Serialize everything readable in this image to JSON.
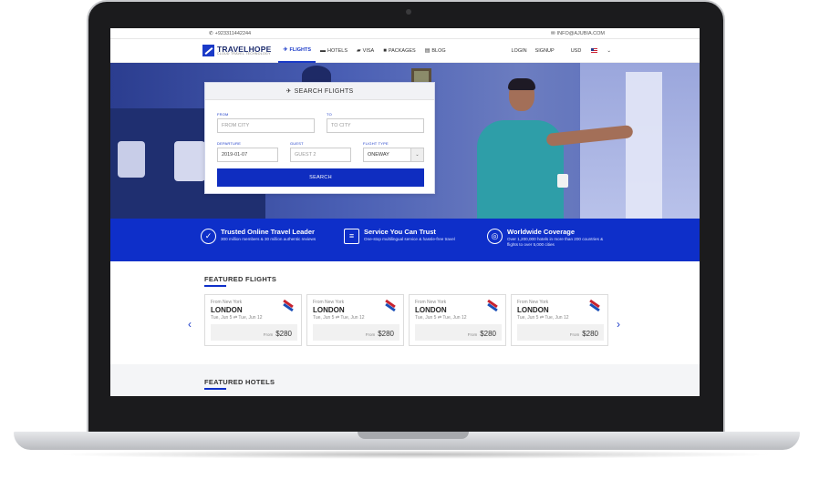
{
  "topbar": {
    "phone": "+923311442244",
    "email": "INFO@AJUBIA.COM"
  },
  "brand": {
    "name": "TRAVELHOPE",
    "tagline": "CLOUD TRAVEL TECHNOLOGY"
  },
  "nav": {
    "items": [
      {
        "label": "FLIGHTS",
        "icon": "plane-icon",
        "active": true
      },
      {
        "label": "HOTELS",
        "icon": "bed-icon"
      },
      {
        "label": "VISA",
        "icon": "passport-icon"
      },
      {
        "label": "PACKAGES",
        "icon": "suitcase-icon"
      },
      {
        "label": "BLOG",
        "icon": "document-icon"
      }
    ],
    "login": "LOGIN",
    "signup": "SIGNUP",
    "currency": "USD"
  },
  "search": {
    "title": "SEARCH FLIGHTS",
    "from_label": "FROM",
    "from_placeholder": "FROM CITY",
    "to_label": "TO",
    "to_placeholder": "TO CITY",
    "departure_label": "DEPARTURE",
    "departure_value": "2019-01-07",
    "guest_label": "GUEST",
    "guest_placeholder": "GUEST 2",
    "type_label": "FLIGHT TYPE",
    "type_value": "ONEWAY",
    "button": "SEARCH"
  },
  "features": [
    {
      "title": "Trusted Online Travel Leader",
      "text": "300 million members & 30 million authentic reviews",
      "icon": "badge-check-icon"
    },
    {
      "title": "Service You Can Trust",
      "text": "One-stop multilingual service & hassle-free travel",
      "icon": "chat-icon"
    },
    {
      "title": "Worldwide Coverage",
      "text": "Over 1,200,000 hotels in more than 200 countries & flights to over 5,000 cities",
      "icon": "globe-icon"
    }
  ],
  "featured_flights": {
    "title": "FEATURED FLIGHTS",
    "cards": [
      {
        "from": "From New York",
        "city": "LONDON",
        "dates": "Tue, Jun 5 ⇄ Tue, Jun 12",
        "price_label": "From",
        "price": "$280"
      },
      {
        "from": "From New York",
        "city": "LONDON",
        "dates": "Tue, Jun 5 ⇄ Tue, Jun 12",
        "price_label": "From",
        "price": "$280"
      },
      {
        "from": "From New York",
        "city": "LONDON",
        "dates": "Tue, Jun 5 ⇄ Tue, Jun 12",
        "price_label": "From",
        "price": "$280"
      },
      {
        "from": "From New York",
        "city": "LONDON",
        "dates": "Tue, Jun 5 ⇄ Tue, Jun 12",
        "price_label": "From",
        "price": "$280"
      }
    ]
  },
  "featured_hotels": {
    "title": "FEATURED HOTELS"
  },
  "colors": {
    "brand_blue": "#0e2fc9",
    "brand_dark": "#1a2a6c"
  }
}
